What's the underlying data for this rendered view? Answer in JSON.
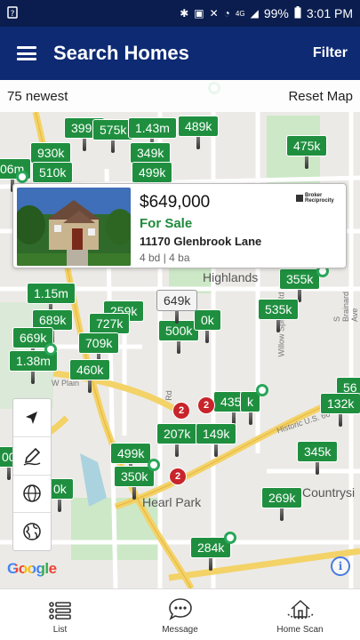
{
  "status_bar": {
    "battery": "99%",
    "time": "3:01 PM",
    "network": "4G"
  },
  "app_bar": {
    "title": "Search Homes",
    "filter_label": "Filter"
  },
  "map": {
    "count_label": "75 newest",
    "reset_label": "Reset Map",
    "place_labels": [
      "Highlands",
      "Hearl Park",
      "Countrysi",
      "Historic U.S. 66",
      "W Plain",
      "Rd",
      "Willow Springs Rd",
      "S Brainard Ave"
    ],
    "pins": [
      {
        "label": "399k"
      },
      {
        "label": "575k"
      },
      {
        "label": "1.43m"
      },
      {
        "label": "489k"
      },
      {
        "label": "475k"
      },
      {
        "label": "930k"
      },
      {
        "label": "349k"
      },
      {
        "label": "06m"
      },
      {
        "label": "510k"
      },
      {
        "label": "499k"
      },
      {
        "label": "355k"
      },
      {
        "label": "1.15m"
      },
      {
        "label": "259k"
      },
      {
        "label": "535k"
      },
      {
        "label": "689k"
      },
      {
        "label": "727k"
      },
      {
        "label": "669k"
      },
      {
        "label": "709k"
      },
      {
        "label": "500k"
      },
      {
        "label": "0k"
      },
      {
        "label": "1.38m"
      },
      {
        "label": "460k"
      },
      {
        "label": "56"
      },
      {
        "label": "435k"
      },
      {
        "label": "k"
      },
      {
        "label": "132k"
      },
      {
        "label": "207k"
      },
      {
        "label": "149k"
      },
      {
        "label": "499k"
      },
      {
        "label": "345k"
      },
      {
        "label": "350k"
      },
      {
        "label": "269k"
      },
      {
        "label": "284k"
      },
      {
        "label": "0k"
      },
      {
        "label": "00"
      }
    ],
    "selected_pin": "649k",
    "cluster_badges": [
      "2",
      "2",
      "2"
    ]
  },
  "listing_card": {
    "price": "$649,000",
    "status": "For Sale",
    "address": "11170 Glenbrook Lane",
    "beds_baths": "4 bd | 4 ba",
    "broker": "Broker Reciprocity"
  },
  "attribution": "Google",
  "bottom_nav": [
    {
      "label": "List",
      "icon": "list-icon"
    },
    {
      "label": "Message",
      "icon": "message-icon"
    },
    {
      "label": "Home Scan",
      "icon": "home-scan-icon"
    }
  ],
  "colors": {
    "app_bar": "#0d2a73",
    "status_bar": "#0a1d4e",
    "pin": "#1f8f3f",
    "badge": "#c8242b"
  }
}
